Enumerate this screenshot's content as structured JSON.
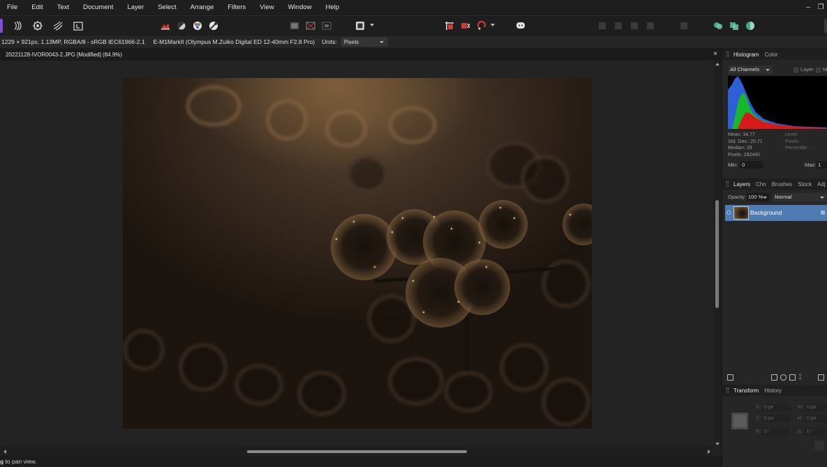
{
  "menu": [
    "File",
    "Edit",
    "Text",
    "Document",
    "Layer",
    "Select",
    "Arrange",
    "Filters",
    "View",
    "Window",
    "Help"
  ],
  "toolbar": {
    "left_icons": [
      "persona-photo-icon",
      "liquify-persona-icon",
      "develop-persona-icon",
      "tone-mapping-persona-icon",
      "export-persona-icon"
    ],
    "adjust_icons": [
      "auto-levels-icon",
      "auto-contrast-icon",
      "auto-colors-icon",
      "auto-white-balance-icon"
    ],
    "selection_icons": [
      "select-all-icon",
      "deselect-icon",
      "invert-selection-icon"
    ],
    "quickmask_icon": "quick-mask-icon",
    "snap_icons": [
      "snapping-icon",
      "force-pixel-alignment-icon",
      "assistant-icon"
    ],
    "chat_icon": "help-bubble-icon",
    "right_icons": [
      "undo-icon",
      "redo-icon",
      "arrange-icon",
      "arrange2-icon",
      "insert-icon",
      "mode1-icon",
      "mode2-icon",
      "mode3-icon"
    ]
  },
  "context": {
    "image_info": "1229 × 921px, 1.13MP, RGBA/8 - sRGB IEC61966-2.1",
    "camera_info": "E-M1MarkII (Olympus M.Zuiko Digital ED 12-40mm F2.8 Pro)",
    "units_label": "Units:",
    "units_value": "Pixels"
  },
  "document": {
    "title": "20221128-IVOR0043-2.JPG [Modified] (84.9%)",
    "close": "×"
  },
  "status": {
    "prefix": "g",
    "text": " to pan view."
  },
  "histogram_panel": {
    "tabs": [
      "Histogram",
      "Color"
    ],
    "channel": "All Channels",
    "layer_label": "Layer",
    "marquee_label": "Ma",
    "stats": [
      "Mean: 34.77",
      "Std. Dev.: 20.71",
      "Median: 29",
      "Pixels: 282440"
    ],
    "stats_right": [
      "Level: -",
      "Pixels: -",
      "Percentile: -"
    ],
    "min_label": "Min:",
    "min_value": "0",
    "max_label": "Max:",
    "max_value": "1"
  },
  "layers_panel": {
    "tabs": [
      "Layers",
      "Chn",
      "Brushes",
      "Stock",
      "Adj"
    ],
    "opacity_label": "Opacity:",
    "opacity_value": "100 %",
    "blend_mode": "Normal",
    "layers": [
      {
        "name": "Background",
        "locked": true
      }
    ]
  },
  "transform_panel": {
    "tabs": [
      "Transform",
      "History"
    ],
    "x_label": "X:",
    "x_value": "0 px",
    "y_label": "Y:",
    "y_value": "0 px",
    "w_label": "W:",
    "w_value": "0 px",
    "h_label": "H:",
    "h_value": "0 px",
    "r_label": "R:",
    "r_value": "0 °",
    "s_label": "S:",
    "s_value": "0 °"
  },
  "colors": {
    "app_bg": "#232323",
    "selection_blue": "#4f7bb3",
    "hist_blue": "#2d5fd6",
    "hist_green": "#18b82c",
    "hist_red": "#d61a1a"
  }
}
